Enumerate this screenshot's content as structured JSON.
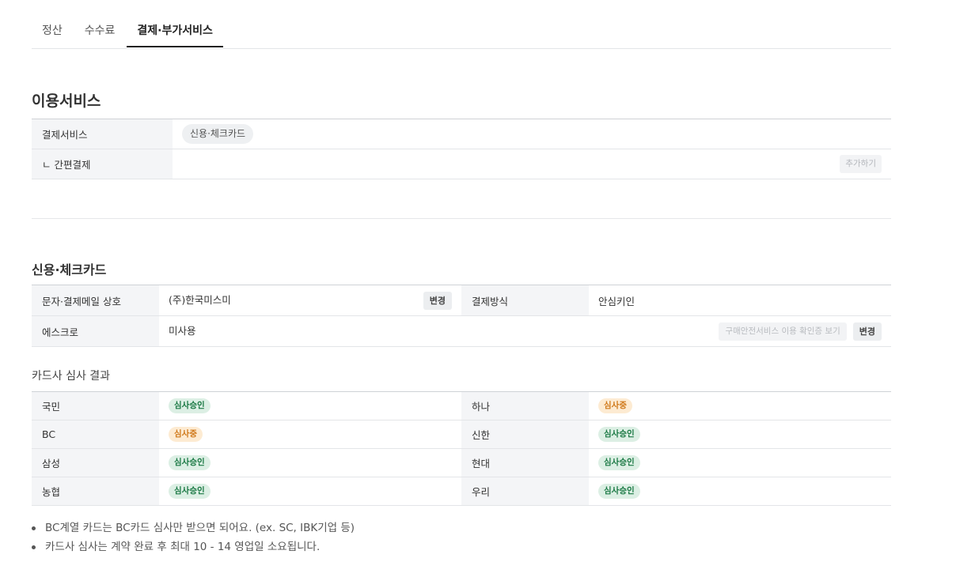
{
  "tabs": [
    {
      "label": "정산"
    },
    {
      "label": "수수료"
    },
    {
      "label": "결제·부가서비스"
    }
  ],
  "services": {
    "title": "이용서비스",
    "payment_label": "결제서비스",
    "payment_value": "신용·체크카드",
    "easy_label": "ㄴ 간편결제",
    "add_button": "추가하기"
  },
  "card": {
    "title": "신용·체크카드",
    "name_label": "문자·결제메일 상호",
    "name_value": "(주)한국미스미",
    "change_button": "변경",
    "method_label": "결제방식",
    "method_value": "안심키인",
    "escrow_label": "에스크로",
    "escrow_value": "미사용",
    "escrow_view_button": "구매안전서비스 이용 확인증 보기",
    "escrow_change_button": "변경"
  },
  "review": {
    "title": "카드사 심사 결과",
    "rows": [
      {
        "left_name": "국민",
        "left_status": "심사승인",
        "right_name": "하나",
        "right_status": "심사중"
      },
      {
        "left_name": "BC",
        "left_status": "심사중",
        "right_name": "신한",
        "right_status": "심사승인"
      },
      {
        "left_name": "삼성",
        "left_status": "심사승인",
        "right_name": "현대",
        "right_status": "심사승인"
      },
      {
        "left_name": "농협",
        "left_status": "심사승인",
        "right_name": "우리",
        "right_status": "심사승인"
      }
    ]
  },
  "notes": [
    "BC계열 카드는 BC카드 심사만 받으면 되어요. (ex. SC, IBK기업 등)",
    "카드사 심사는 계약 완료 후 최대 10 - 14 영업일 소요됩니다."
  ],
  "colors": {
    "approved_bg": "#dcefe4",
    "approved_text": "#1c7a45",
    "pending_bg": "#fdebd2",
    "pending_text": "#d07a1c"
  }
}
